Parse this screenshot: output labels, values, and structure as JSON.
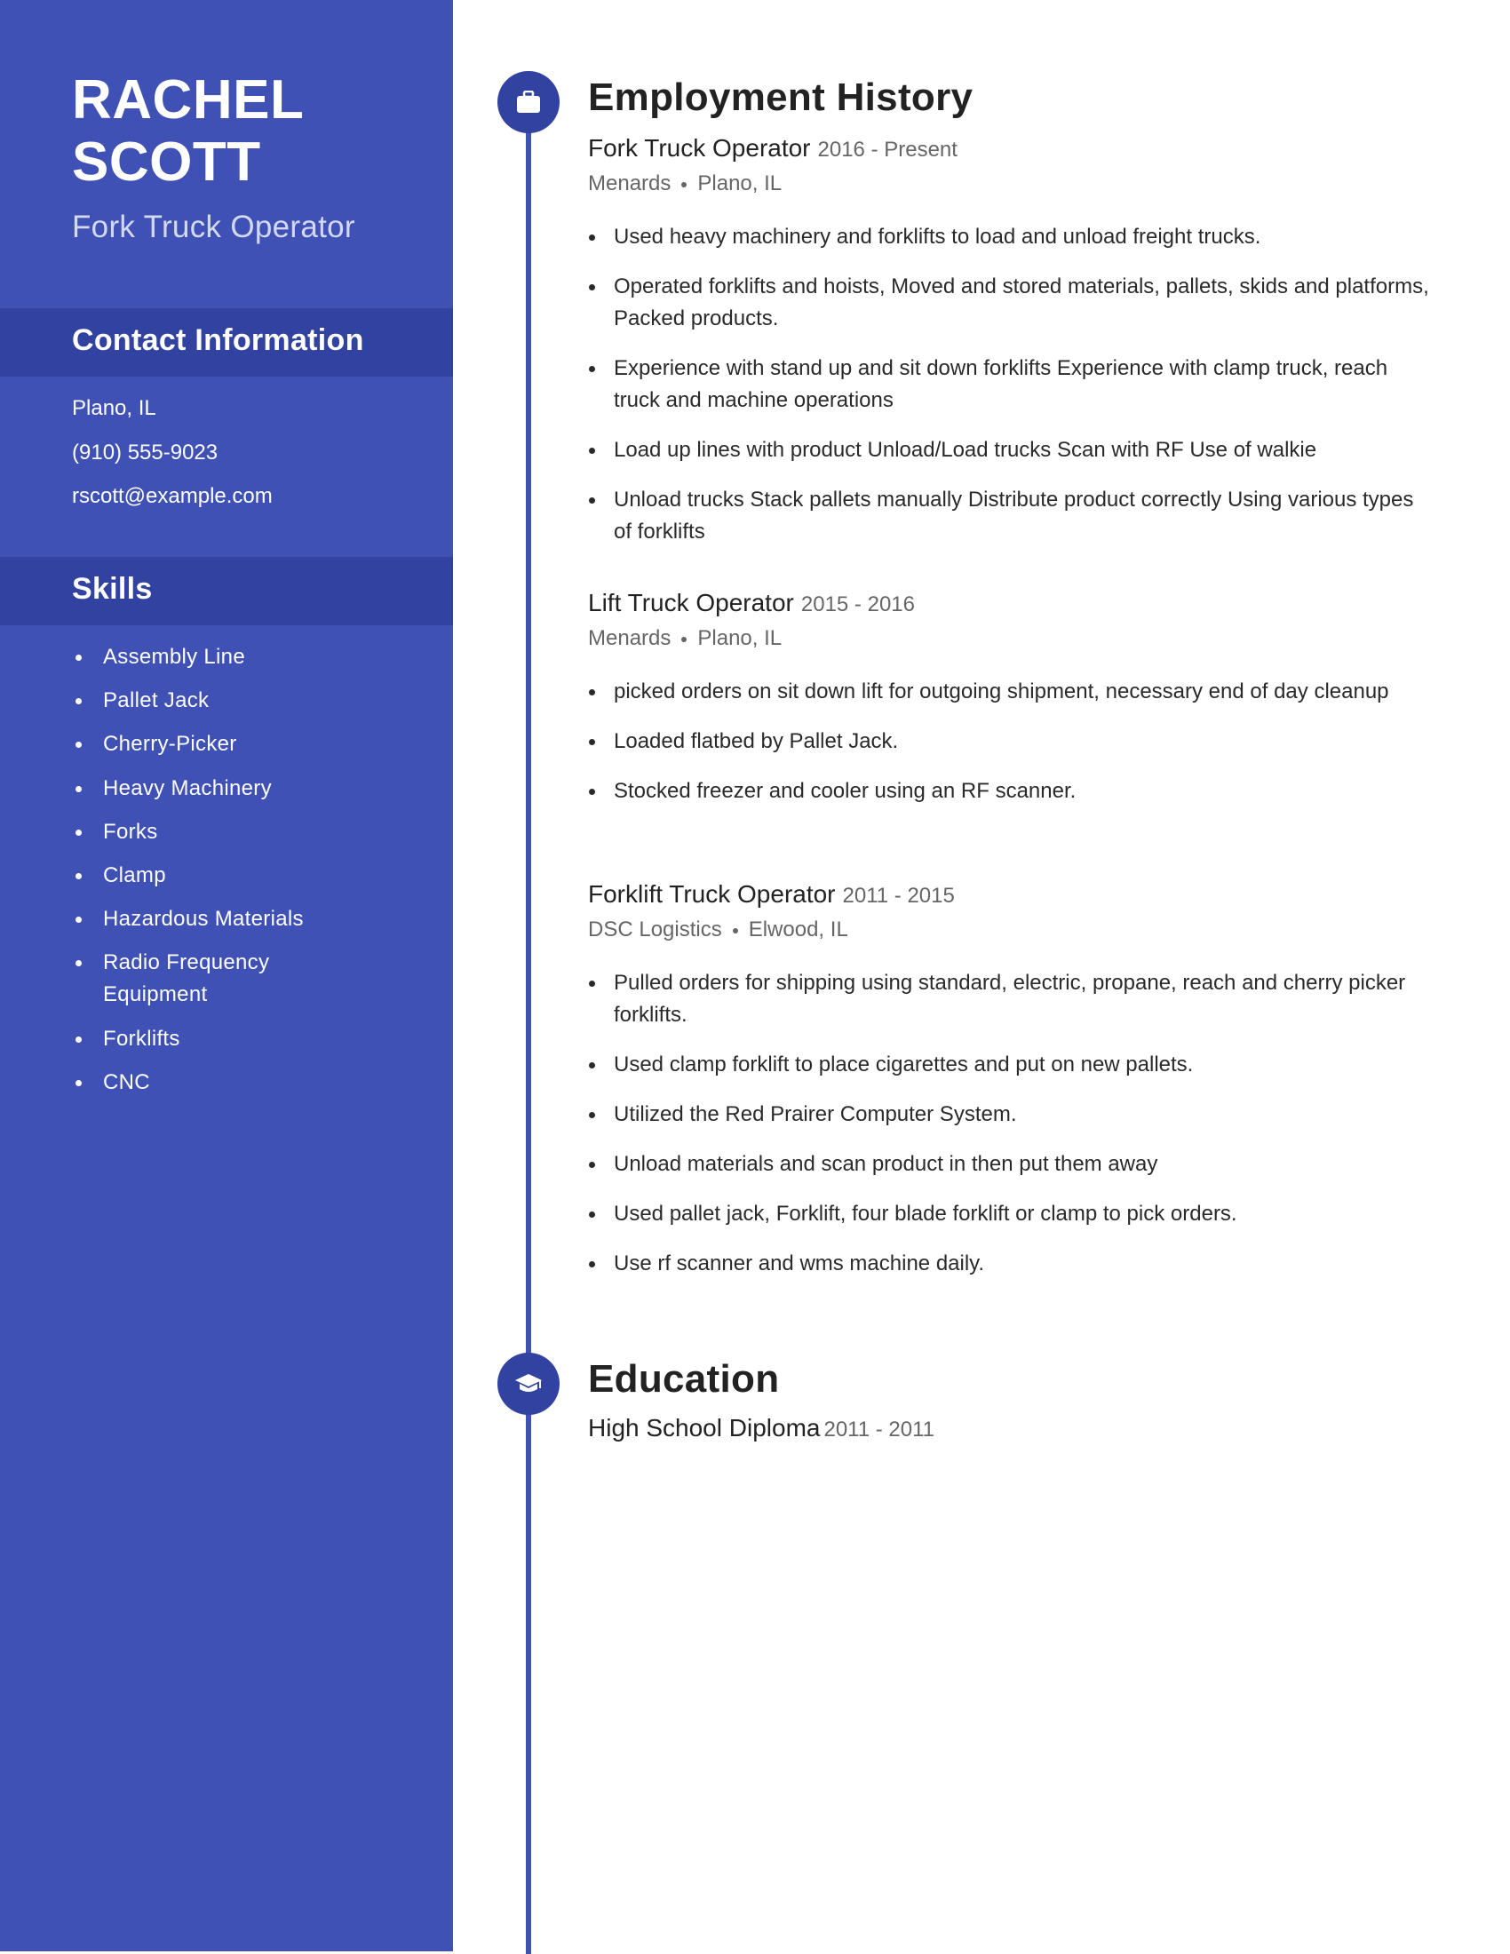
{
  "profile": {
    "first_name": "RACHEL",
    "last_name": "SCOTT",
    "headline": "Fork Truck Operator"
  },
  "contact": {
    "title": "Contact Information",
    "items": [
      "Plano, IL",
      "(910) 555-9023",
      "rscott@example.com"
    ]
  },
  "skills": {
    "title": "Skills",
    "items": [
      "Assembly Line",
      "Pallet Jack",
      "Cherry-Picker",
      "Heavy Machinery",
      "Forks",
      "Clamp",
      "Hazardous Materials",
      "Radio Frequency Equipment",
      "Forklifts",
      "CNC"
    ]
  },
  "employment": {
    "title": "Employment History",
    "icon": "briefcase-icon",
    "jobs": [
      {
        "title": "Fork Truck Operator",
        "dates": "2016 - Present",
        "company": "Menards",
        "location": "Plano, IL",
        "bullets": [
          "Used heavy machinery and forklifts to load and unload freight trucks.",
          "Operated forklifts and hoists, Moved and stored materials, pallets, skids and platforms, Packed products.",
          "Experience with stand up and sit down forklifts Experience with clamp truck, reach truck and machine operations",
          "Load up lines with product Unload/Load trucks Scan with RF Use of walkie",
          "Unload trucks Stack pallets manually Distribute product correctly Using various types of forklifts"
        ]
      },
      {
        "title": "Lift Truck Operator",
        "dates": "2015 - 2016",
        "company": "Menards",
        "location": "Plano, IL",
        "bullets": [
          "picked orders on sit down lift for outgoing shipment, necessary end of day cleanup",
          "Loaded flatbed by Pallet Jack.",
          "Stocked freezer and cooler using an RF scanner."
        ]
      },
      {
        "title": "Forklift Truck Operator",
        "dates": "2011 - 2015",
        "company": "DSC Logistics",
        "location": "Elwood, IL",
        "bullets": [
          "Pulled orders for shipping using standard, electric, propane, reach and cherry picker forklifts.",
          "Used clamp forklift to place cigarettes and put on new pallets.",
          "Utilized the Red Prairer Computer System.",
          "Unload materials and scan product in then put them away",
          "Used pallet jack, Forklift, four blade forklift or clamp to pick orders.",
          "Use rf scanner and wms machine daily."
        ]
      }
    ]
  },
  "education": {
    "title": "Education",
    "icon": "graduation-cap-icon",
    "entries": [
      {
        "degree": "High School Diploma",
        "dates": "2011 - 2011"
      }
    ]
  },
  "colors": {
    "sidebar": "#3f51b5",
    "band": "#3142a0",
    "timeline": "#3f51b5",
    "text": "#222222",
    "muted": "#666666"
  }
}
